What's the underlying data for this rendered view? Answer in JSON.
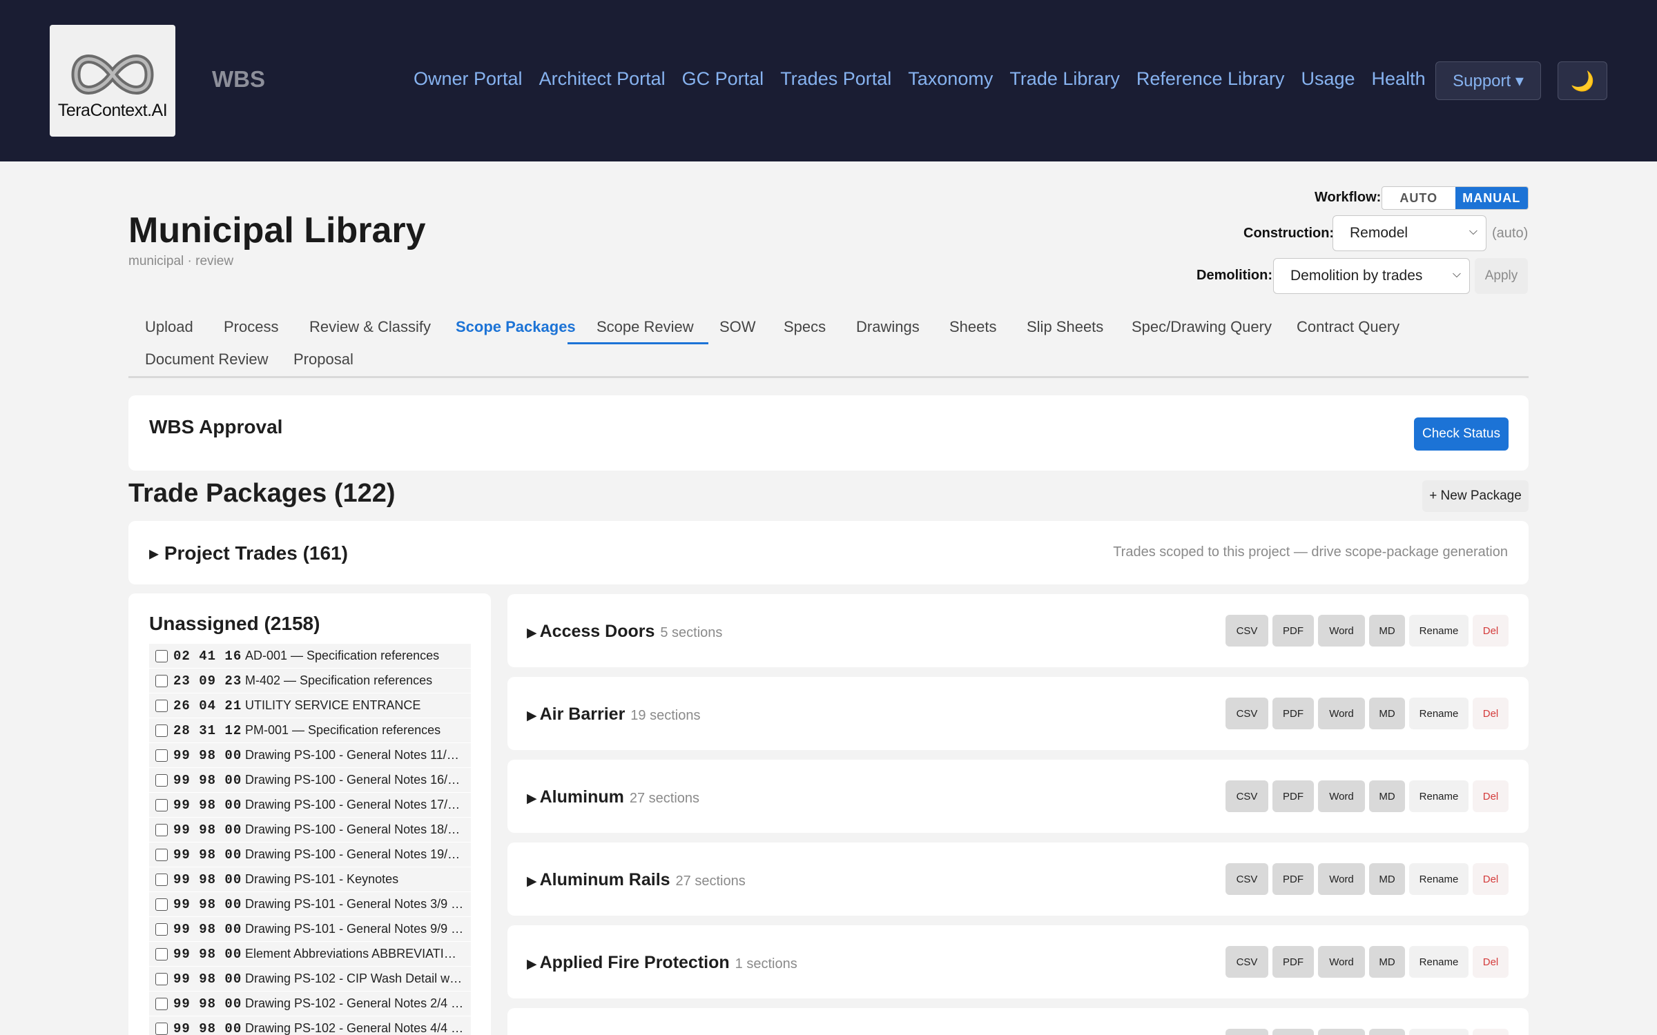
{
  "header": {
    "logo_text": "TeraContext.AI",
    "brand": "WBS",
    "nav": [
      "Owner Portal",
      "Architect Portal",
      "GC Portal",
      "Trades Portal",
      "Taxonomy",
      "Trade Library",
      "Reference Library",
      "Usage",
      "Health"
    ],
    "support_label": "Support ▾",
    "theme_icon": "moon-icon",
    "theme_glyph": "🌙"
  },
  "page": {
    "title": "Municipal Library",
    "subtitle": "municipal · review"
  },
  "controls": {
    "workflow_label": "Workflow:",
    "workflow_options": [
      "AUTO",
      "MANUAL"
    ],
    "workflow_selected": "MANUAL",
    "construction_label": "Construction:",
    "construction_value": "Remodel",
    "construction_note": "(auto)",
    "demolition_label": "Demolition:",
    "demolition_value": "Demolition by trades",
    "apply_label": "Apply"
  },
  "tabs": {
    "items": [
      "Upload",
      "Process",
      "Review & Classify",
      "Scope Packages",
      "Scope Review",
      "SOW",
      "Specs",
      "Drawings",
      "Sheets",
      "Slip Sheets",
      "Spec/Drawing Query",
      "Contract Query",
      "Document Review",
      "Proposal"
    ],
    "active": "Scope Packages"
  },
  "wbs_approval": {
    "title": "WBS Approval",
    "check_label": "Check Status"
  },
  "trade_packages": {
    "title": "Trade Packages (122)",
    "new_label": "+ New Package"
  },
  "project_trades": {
    "title": "▸ Project Trades (161)",
    "note": "Trades scoped to this project — drive scope-package generation"
  },
  "unassigned": {
    "title": "Unassigned (2158)",
    "rows": [
      {
        "code": "02 41 16",
        "text": "AD-001 — Specification references"
      },
      {
        "code": "23 09 23",
        "text": "M-402 — Specification references"
      },
      {
        "code": "26 04 21",
        "text": "UTILITY SERVICE ENTRANCE"
      },
      {
        "code": "28 31 12",
        "text": "PM-001 — Specification references"
      },
      {
        "code": "99 98 00",
        "text": "Drawing PS-100 - General Notes 11/2…"
      },
      {
        "code": "99 98 00",
        "text": "Drawing PS-100 - General Notes 16/2…"
      },
      {
        "code": "99 98 00",
        "text": "Drawing PS-100 - General Notes 17/2…"
      },
      {
        "code": "99 98 00",
        "text": "Drawing PS-100 - General Notes 18/2…"
      },
      {
        "code": "99 98 00",
        "text": "Drawing PS-100 - General Notes 19/2…"
      },
      {
        "code": "99 98 00",
        "text": "Drawing PS-101 - Keynotes"
      },
      {
        "code": "99 98 00",
        "text": "Drawing PS-101 - General Notes 3/9 —…"
      },
      {
        "code": "99 98 00",
        "text": "Drawing PS-101 - General Notes 9/9 —…"
      },
      {
        "code": "99 98 00",
        "text": "Element Abbreviations ABBREVIATIO…"
      },
      {
        "code": "99 98 00",
        "text": "Drawing PS-102 - CIP Wash Detail wit…"
      },
      {
        "code": "99 98 00",
        "text": "Drawing PS-102 - General Notes 2/4 —…"
      },
      {
        "code": "99 98 00",
        "text": "Drawing PS-102 - General Notes 4/4 —…"
      }
    ]
  },
  "packages": {
    "buttons": [
      "CSV",
      "PDF",
      "Word",
      "MD",
      "Rename",
      "Del"
    ],
    "items": [
      {
        "name": "Access Doors",
        "count": "5 sections"
      },
      {
        "name": "Air Barrier",
        "count": "19 sections"
      },
      {
        "name": "Aluminum",
        "count": "27 sections"
      },
      {
        "name": "Aluminum Rails",
        "count": "27 sections"
      },
      {
        "name": "Applied Fire Protection",
        "count": "1 sections"
      },
      {
        "name": "",
        "count": ""
      }
    ]
  }
}
